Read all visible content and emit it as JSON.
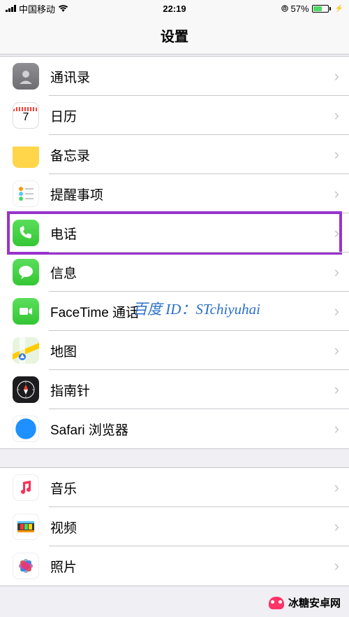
{
  "status": {
    "carrier": "中国移动",
    "time": "22:19",
    "battery_pct": "57%"
  },
  "header": {
    "title": "设置"
  },
  "group1": {
    "contacts": "通讯录",
    "calendar": "日历",
    "calendar_day": "7",
    "notes": "备忘录",
    "reminders": "提醒事项",
    "phone": "电话",
    "messages": "信息",
    "facetime": "FaceTime 通话",
    "maps": "地图",
    "compass": "指南针",
    "safari": "Safari 浏览器"
  },
  "group2": {
    "music": "音乐",
    "videos": "视频",
    "photos": "照片"
  },
  "watermark": {
    "baidu": "百度 ID：STchiyuhai",
    "brand": "冰糖安卓网"
  }
}
